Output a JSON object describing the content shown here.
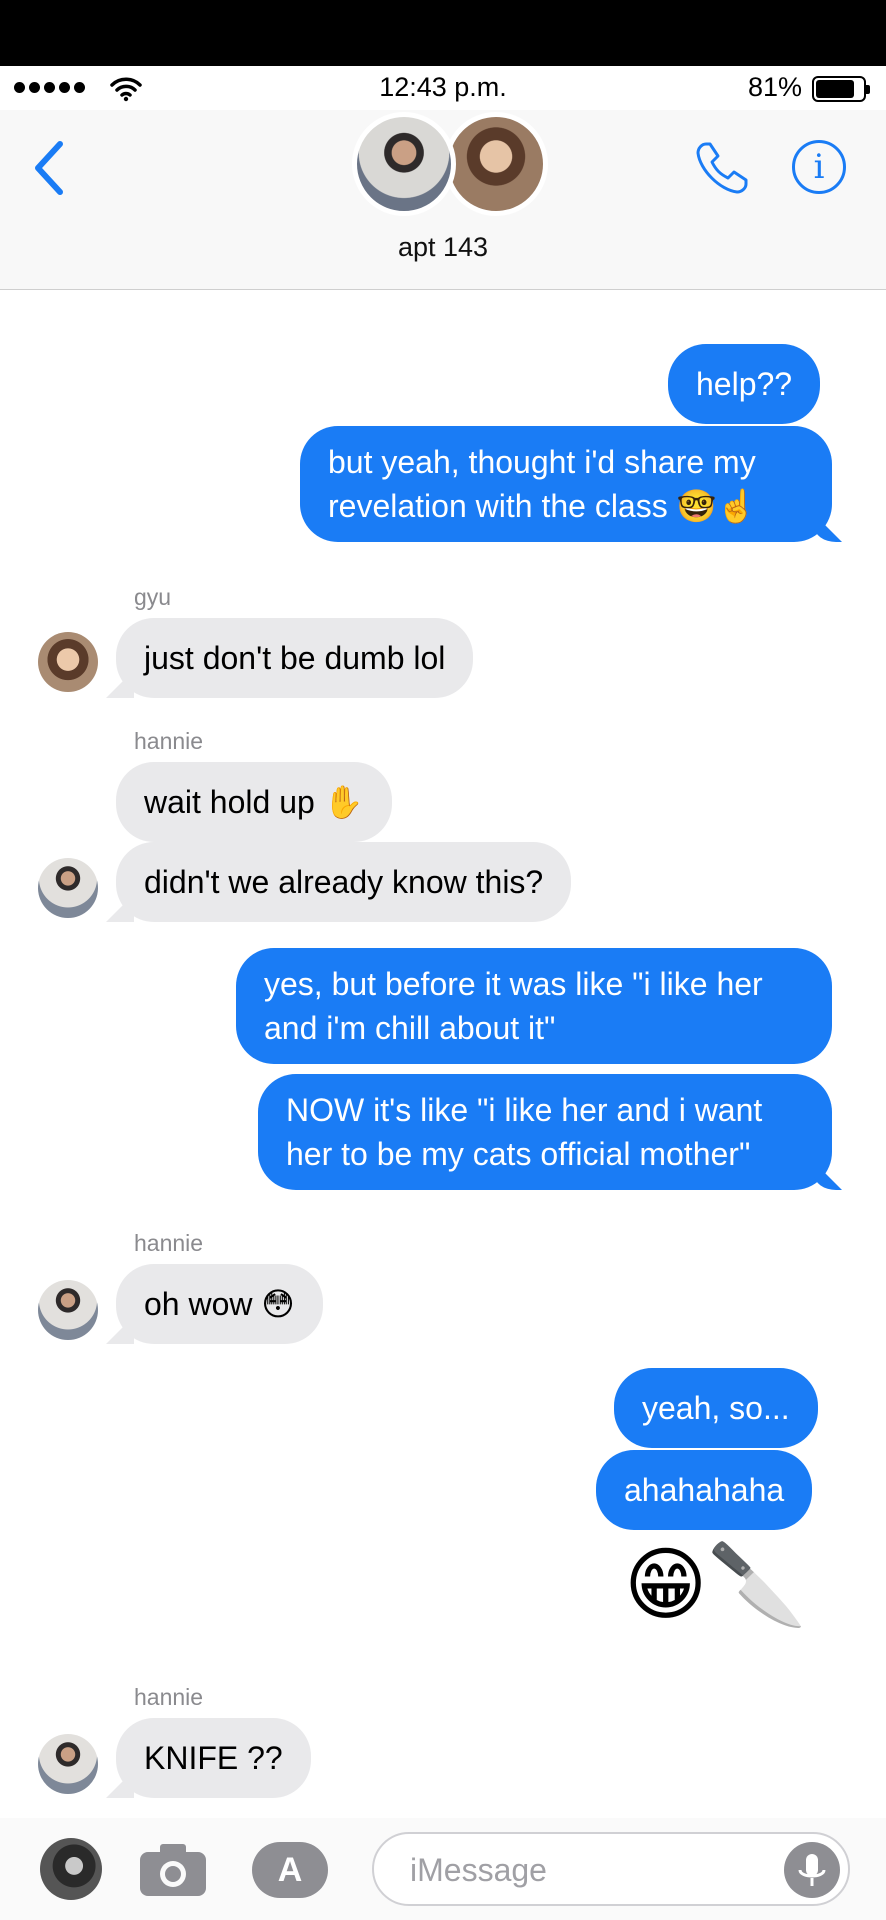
{
  "status_bar": {
    "time": "12:43 p.m.",
    "battery": "81%",
    "battery_level": 0.81
  },
  "header": {
    "group_name": "apt 143"
  },
  "messages": {
    "m1": "help??",
    "m2": "but yeah, thought i'd share my revelation with the class 🤓☝️",
    "gyu_name": "gyu",
    "m3": "just don't be dumb lol",
    "hannie_name_1": "hannie",
    "m4": "wait hold up ✋",
    "m5": "didn't we already know this?",
    "m6": "yes, but before it was like \"i like her and i'm chill about it\"",
    "m7": "NOW it's like \"i like her and i want her to be my cats official mother\"",
    "hannie_name_2": "hannie",
    "m8": "oh wow 😳",
    "m9": "yeah, so...",
    "m10": "ahahahaha",
    "m11": "😁🔪",
    "hannie_name_3": "hannie",
    "m12": "KNIFE ??"
  },
  "composer": {
    "placeholder": "iMessage"
  },
  "colors": {
    "outgoing": "#1a7cf5",
    "incoming": "#e9e9eb",
    "accent": "#1a7cf5"
  },
  "icons": [
    "wifi-icon",
    "back-chevron-icon",
    "phone-icon",
    "info-icon",
    "camera-icon",
    "app-store-icon",
    "microphone-icon"
  ]
}
